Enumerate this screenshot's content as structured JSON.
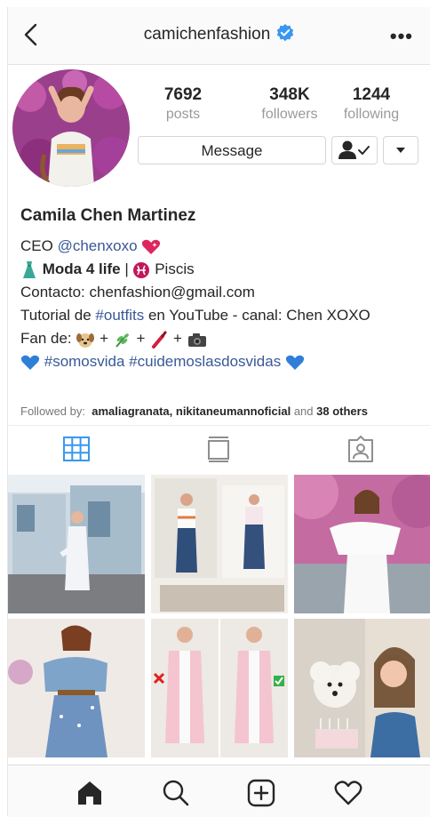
{
  "header": {
    "username": "camichenfashion",
    "back_icon": "chevron-left-icon",
    "verified_icon": "verified-badge-icon",
    "more_icon": "more-icon"
  },
  "stats": {
    "posts_count": "7692",
    "posts_label": "posts",
    "followers_count": "348K",
    "followers_label": "followers",
    "following_count": "1244",
    "following_label": "following"
  },
  "actions": {
    "message_label": "Message"
  },
  "bio": {
    "name": "Camila Chen Martinez",
    "line1_prefix": "CEO ",
    "line1_mention": "@chenxoxo",
    "line2_bold": "Moda 4 life",
    "line2_sep": " | ",
    "line2_sign": "Piscis",
    "line3": "Contacto: chenfashion@gmail.com",
    "line4_prefix": "Tutorial de ",
    "line4_tag": "#outfits",
    "line4_suffix": " en YouTube - canal: Chen XOXO",
    "line5_prefix": "Fan de:",
    "line5_plus": "+",
    "line6_tags": "#somosvida #cuidemoslasdosvidas"
  },
  "followed_by": {
    "prefix": "Followed by:",
    "names": "amaliagranata, nikitaneumannoficial",
    "and": "and",
    "others": "38 others"
  },
  "colors": {
    "link": "#385898",
    "tab_active": "#3897f0",
    "verified": "#3897f0"
  }
}
